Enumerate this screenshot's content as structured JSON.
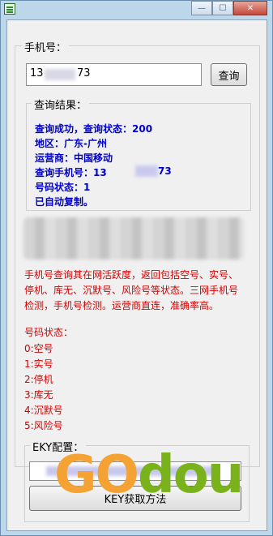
{
  "window": {
    "title": ""
  },
  "caption": {
    "minimize": "—",
    "maximize": "☐",
    "close": "✕"
  },
  "phone_group": {
    "legend": "手机号：",
    "input_value": "13",
    "input_suffix": "73",
    "query_button": "查询"
  },
  "result_group": {
    "legend": "查询结果：",
    "lines": [
      "查询成功，查询状态：200",
      "地区：广东-广州",
      "运营商：中国移动",
      "查询手机号：13",
      "号码状态：1",
      "已自动复制。"
    ],
    "phone_suffix": "73"
  },
  "description": {
    "lines": [
      "手机号查询其在网活跃度，返回包括空号、实号、",
      "停机、库无、沉默号、风险号等状态。三网手机号",
      "检测，手机号检测。运营商直连，准确率高。"
    ]
  },
  "status_legend": {
    "title": "号码状态：",
    "items": [
      "0:空号",
      "1:实号",
      "2:停机",
      "3:库无",
      "4:沉默号",
      "5:风险号"
    ]
  },
  "key_group": {
    "legend": "EKY配置：",
    "get_key_button": "KEY获取方法"
  },
  "watermark": {
    "text_a": "GO",
    "text_b": "dou"
  },
  "colors": {
    "result_text": "#0000cc",
    "desc_text": "#d40000"
  }
}
